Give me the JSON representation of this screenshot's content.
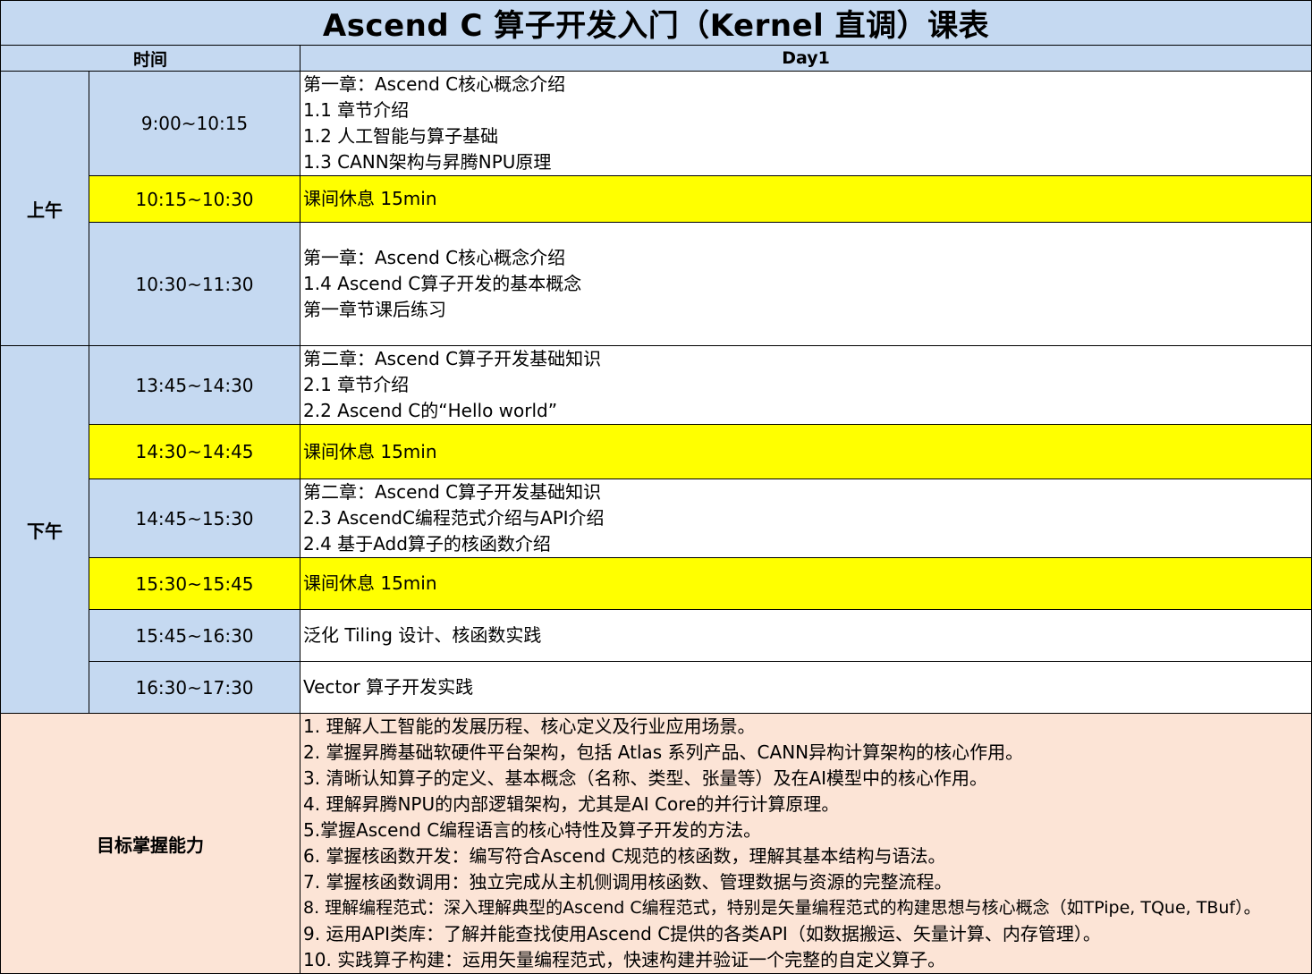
{
  "title": "Ascend C 算子开发入门（Kernel 直调）课表",
  "header": {
    "time": "时间",
    "day": "Day1"
  },
  "periods": {
    "morning": "上午",
    "afternoon": "下午"
  },
  "rows": [
    {
      "time": "9:00~10:15",
      "lines": [
        "第一章：Ascend C核心概念介绍",
        "1.1 章节介绍",
        "1.2 人工智能与算子基础",
        "1.3 CANN架构与昇腾NPU原理"
      ]
    },
    {
      "time": "10:15~10:30",
      "lines": [
        "课间休息 15min"
      ]
    },
    {
      "time": "10:30~11:30",
      "lines": [
        "第一章：Ascend C核心概念介绍",
        "1.4 Ascend C算子开发的基本概念",
        "第一章节课后练习"
      ]
    },
    {
      "time": "13:45~14:30",
      "lines": [
        "第二章：Ascend C算子开发基础知识",
        "2.1 章节介绍",
        "2.2 Ascend C的“Hello world”"
      ]
    },
    {
      "time": "14:30~14:45",
      "lines": [
        "课间休息 15min"
      ]
    },
    {
      "time": "14:45~15:30",
      "lines": [
        "第二章：Ascend C算子开发基础知识",
        "2.3 AscendC编程范式介绍与API介绍",
        "2.4 基于Add算子的核函数介绍"
      ]
    },
    {
      "time": "15:30~15:45",
      "lines": [
        "课间休息 15min"
      ]
    },
    {
      "time": "15:45~16:30",
      "lines": [
        "泛化 Tiling 设计、核函数实践"
      ]
    },
    {
      "time": "16:30~17:30",
      "lines": [
        "Vector 算子开发实践"
      ]
    }
  ],
  "goals": {
    "label": "目标掌握能力",
    "items": [
      "1. 理解人工智能的发展历程、核心定义及行业应用场景。",
      "2. 掌握昇腾基础软硬件平台架构，包括 Atlas 系列产品、CANN异构计算架构的核心作用。",
      "3. 清晰认知算子的定义、基本概念（名称、类型、张量等）及在AI模型中的核心作用。",
      "4. 理解昇腾NPU的内部逻辑架构，尤其是AI Core的并行计算原理。",
      "5.掌握Ascend C编程语言的核心特性及算子开发的方法。",
      "6. 掌握核函数开发：编写符合Ascend C规范的核函数，理解其基本结构与语法。",
      "7. 掌握核函数调用：独立完成从主机侧调用核函数、管理数据与资源的完整流程。",
      "8. 理解编程范式：深入理解典型的Ascend C编程范式，特别是矢量编程范式的构建思想与核心概念（如TPipe, TQue, TBuf）。",
      "9. 运用API类库：了解并能查找使用Ascend C提供的各类API（如数据搬运、矢量计算、内存管理）。",
      "10. 实践算子构建：运用矢量编程范式，快速构建并验证一个完整的自定义算子。"
    ]
  },
  "colors": {
    "header_blue": "#c5d9f1",
    "break_yellow": "#ffff00",
    "goals_peach": "#fce4d6"
  }
}
